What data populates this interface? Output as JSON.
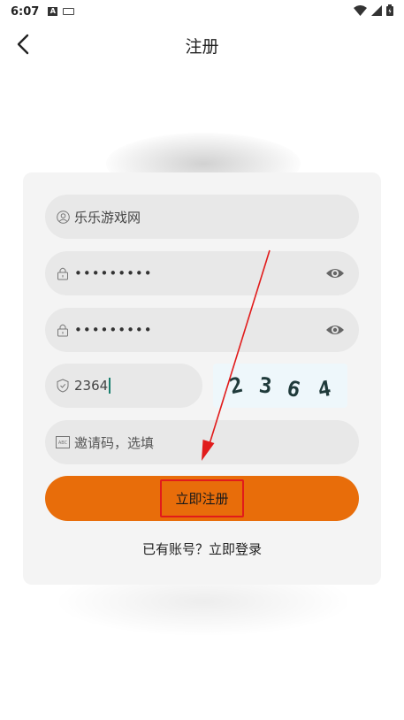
{
  "status_bar": {
    "time": "6:07",
    "icons": [
      "a-notification-icon",
      "keyboard-icon",
      "wifi-icon",
      "signal-icon",
      "battery-icon"
    ]
  },
  "header": {
    "title": "注册",
    "back_icon": "chevron-left-icon"
  },
  "form": {
    "username": {
      "value": "乐乐游戏网",
      "icon": "user-icon"
    },
    "password": {
      "value": "•••••••••",
      "icon": "lock-icon",
      "toggle_icon": "eye-icon"
    },
    "confirm_password": {
      "value": "•••••••••",
      "icon": "lock-icon",
      "toggle_icon": "eye-icon"
    },
    "captcha": {
      "value": "2364",
      "icon": "shield-icon",
      "image_digits": [
        "2",
        "3",
        "6",
        "4"
      ]
    },
    "invite_code": {
      "placeholder": "邀请码，选填",
      "icon": "abc-icon"
    },
    "register_button": "立即注册",
    "login_link": "已有账号？立即登录"
  },
  "colors": {
    "accent": "#e86d0a",
    "highlight_box": "#e11b1b",
    "annotation_arrow": "#e11b1b",
    "card_bg": "#f4f4f4",
    "field_bg": "#e8e8e8"
  }
}
